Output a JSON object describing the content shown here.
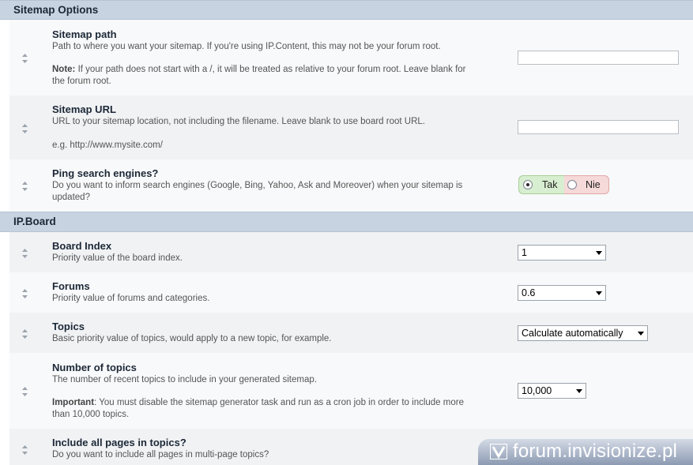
{
  "sections": {
    "sitemap_options": "Sitemap Options",
    "ipboard": "IP.Board"
  },
  "settings": {
    "sitemap_path": {
      "label": "Sitemap path",
      "desc": "Path to where you want your sitemap. If you're using IP.Content, this may not be your forum root.",
      "note_label": "Note:",
      "note_text": " If your path does not start with a /, it will be treated as relative to your forum root. Leave blank for the forum root.",
      "value": ""
    },
    "sitemap_url": {
      "label": "Sitemap URL",
      "desc": "URL to your sitemap location, not including the filename. Leave blank to use board root URL.",
      "example": "e.g. http://www.mysite.com/",
      "value": ""
    },
    "ping": {
      "label": "Ping search engines?",
      "desc": "Do you want to inform search engines (Google, Bing, Yahoo, Ask and Moreover) when your sitemap is updated?",
      "yes_label": "Tak",
      "no_label": "Nie",
      "selected": "Tak"
    },
    "board_index": {
      "label": "Board Index",
      "desc": "Priority value of the board index.",
      "value": "1"
    },
    "forums": {
      "label": "Forums",
      "desc": "Priority value of forums and categories.",
      "value": "0.6"
    },
    "topics": {
      "label": "Topics",
      "desc": "Basic priority value of topics, would apply to a new topic, for example.",
      "value": "Calculate automatically"
    },
    "num_topics": {
      "label": "Number of topics",
      "desc": "The number of recent topics to include in your generated sitemap.",
      "important_label": "Important",
      "important_text": ": You must disable the sitemap generator task and run as a cron job in order to include more than 10,000 topics.",
      "value": "10,000"
    },
    "all_pages": {
      "label": "Include all pages in topics?",
      "desc": "Do you want to include all pages in multi-page topics?"
    }
  },
  "watermark": {
    "text": "forum.invisionize.pl"
  },
  "icons": {
    "drag_handle": "drag-handle-icon",
    "radio": "radio-button-icon",
    "dropdown": "chevron-down-icon",
    "watermark_logo": "invisionize-logo-icon"
  },
  "colors": {
    "section_header_bg": "#c7d3e0",
    "row_alt_bg": "#f0f2f4",
    "yes_bg": "#d8eed0",
    "no_bg": "#f6d9d9"
  }
}
